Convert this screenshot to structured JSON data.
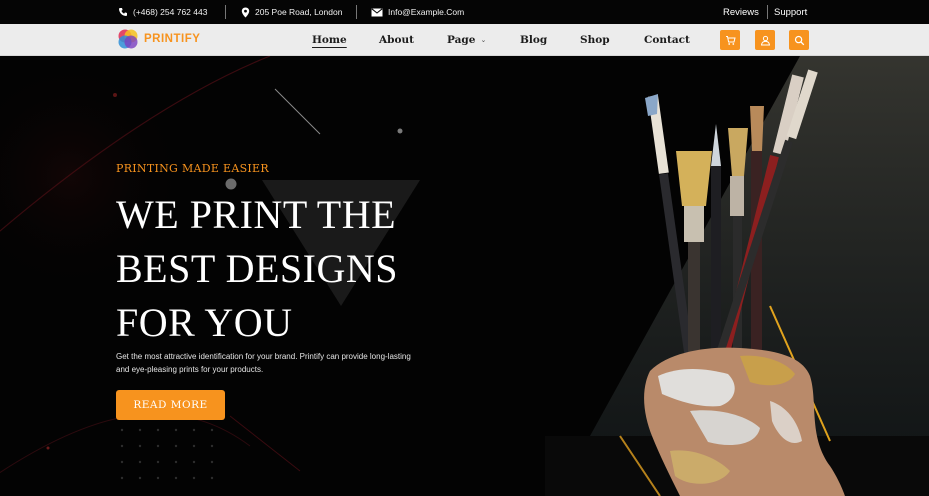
{
  "topbar": {
    "phone": "(+468) 254 762 443",
    "address": "205 Poe Road, London",
    "email": "Info@Example.Com",
    "reviews": "Reviews",
    "support": "Support"
  },
  "brand": {
    "name": "PRINTIFY"
  },
  "nav": {
    "home": "Home",
    "about": "About",
    "page": "Page",
    "blog": "Blog",
    "shop": "Shop",
    "contact": "Contact"
  },
  "icons": {
    "cart": "cart-icon",
    "user": "user-icon",
    "search": "search-icon"
  },
  "hero": {
    "eyebrow": "PRINTING MADE EASIER",
    "headline_line1": "WE PRINT THE",
    "headline_line2": "BEST DESIGNS",
    "headline_line3": "FOR YOU",
    "description": "Get the most attractive identification for your brand. Printify can provide long-lasting and eye-pleasing prints for your products.",
    "cta_label": "READ MORE"
  },
  "colors": {
    "accent": "#f7931e",
    "background": "#030303",
    "header": "#ececec"
  }
}
